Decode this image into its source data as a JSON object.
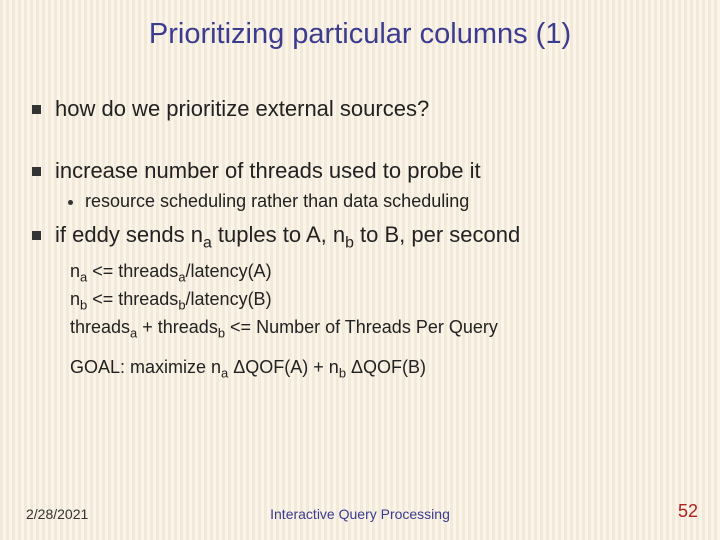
{
  "title": "Prioritizing particular columns (1)",
  "bullets": {
    "b1": "how do we prioritize external sources?",
    "b2": "increase number of threads used to probe it",
    "b2_sub": "resource scheduling rather than data scheduling",
    "b3_pre": "if eddy sends n",
    "b3_a": "a",
    "b3_mid1": " tuples to A, n",
    "b3_b": "b",
    "b3_mid2": " to B, per second"
  },
  "eq": {
    "l1_pre": "n",
    "l1_a": "a",
    "l1_mid": " <= threads",
    "l1_a2": "a",
    "l1_post": "/latency(A)",
    "l2_pre": "n",
    "l2_b": "b",
    "l2_mid": " <= threads",
    "l2_b2": "b",
    "l2_post": "/latency(B)",
    "l3_pre": "threads",
    "l3_a": "a",
    "l3_mid": " + threads",
    "l3_b": "b",
    "l3_post": " <= Number of Threads Per Query"
  },
  "goal": {
    "pre": "GOAL: maximize  n",
    "a": "a",
    "mid1": " ΔQOF(A) + n",
    "b": "b",
    "mid2": " ΔQOF(B)"
  },
  "footer": {
    "date": "2/28/2021",
    "title": "Interactive Query Processing",
    "page": "52"
  }
}
